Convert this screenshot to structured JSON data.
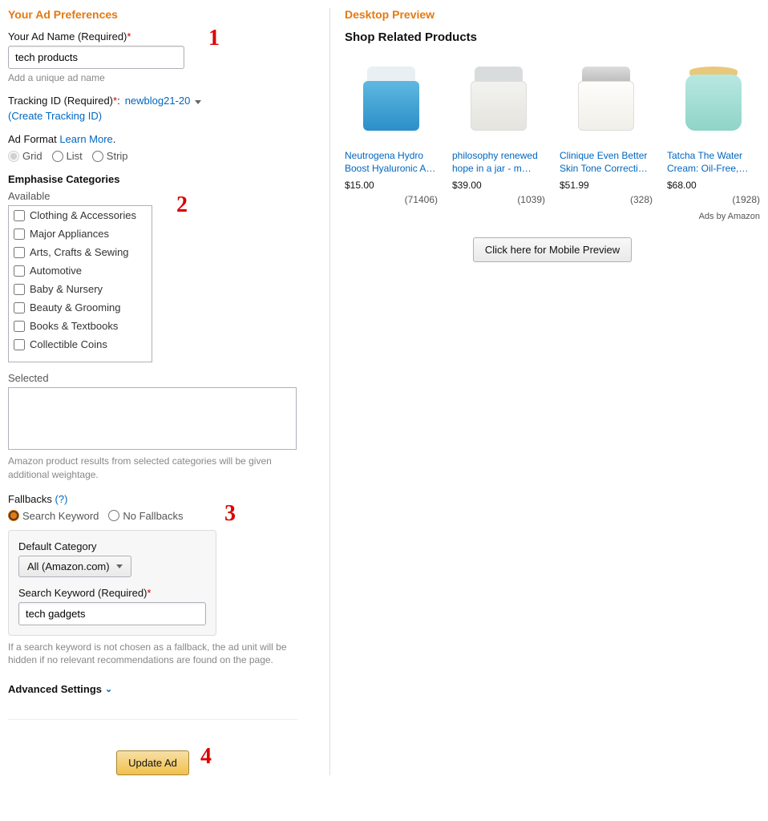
{
  "left": {
    "header": "Your Ad Preferences",
    "ad_name": {
      "label": "Your Ad Name (Required)",
      "value": "tech products",
      "help": "Add a unique ad name"
    },
    "tracking": {
      "label": "Tracking ID (Required)",
      "value": "newblog21-20",
      "create_link": "(Create Tracking ID)"
    },
    "ad_format": {
      "label": "Ad Format",
      "learn_more": "Learn More",
      "options": [
        "Grid",
        "List",
        "Strip"
      ],
      "selected": "Grid"
    },
    "emphasise": {
      "title": "Emphasise Categories",
      "available_label": "Available",
      "categories": [
        "Clothing & Accessories",
        "Major Appliances",
        "Arts, Crafts & Sewing",
        "Automotive",
        "Baby & Nursery",
        "Beauty & Grooming",
        "Books & Textbooks",
        "Collectible Coins"
      ],
      "selected_label": "Selected",
      "note": "Amazon product results from selected categories will be given additional weightage."
    },
    "fallbacks": {
      "title": "Fallbacks",
      "help": "(?)",
      "options": [
        "Search Keyword",
        "No Fallbacks"
      ],
      "selected": "Search Keyword",
      "default_category_label": "Default Category",
      "default_category_value": "All (Amazon.com)",
      "search_keyword_label": "Search Keyword (Required)",
      "search_keyword_value": "tech gadgets",
      "note": "If a search keyword is not chosen as a fallback, the ad unit will be hidden if no relevant recommendations are found on the page."
    },
    "advanced_label": "Advanced Settings",
    "update_button": "Update Ad"
  },
  "right": {
    "header": "Desktop Preview",
    "subtitle": "Shop Related Products",
    "products": [
      {
        "name": "Neutrogena Hydro Boost Hyaluronic A…",
        "price": "$15.00",
        "count": "(71406)"
      },
      {
        "name": "philosophy renewed hope in a jar - m…",
        "price": "$39.00",
        "count": "(1039)"
      },
      {
        "name": "Clinique Even Better Skin Tone Correcti…",
        "price": "$51.99",
        "count": "(328)"
      },
      {
        "name": "Tatcha The Water Cream: Oil-Free,…",
        "price": "$68.00",
        "count": "(1928)"
      }
    ],
    "ads_by": "Ads by Amazon",
    "mobile_button": "Click here for Mobile Preview"
  },
  "annotations": [
    "1",
    "2",
    "3",
    "4"
  ]
}
